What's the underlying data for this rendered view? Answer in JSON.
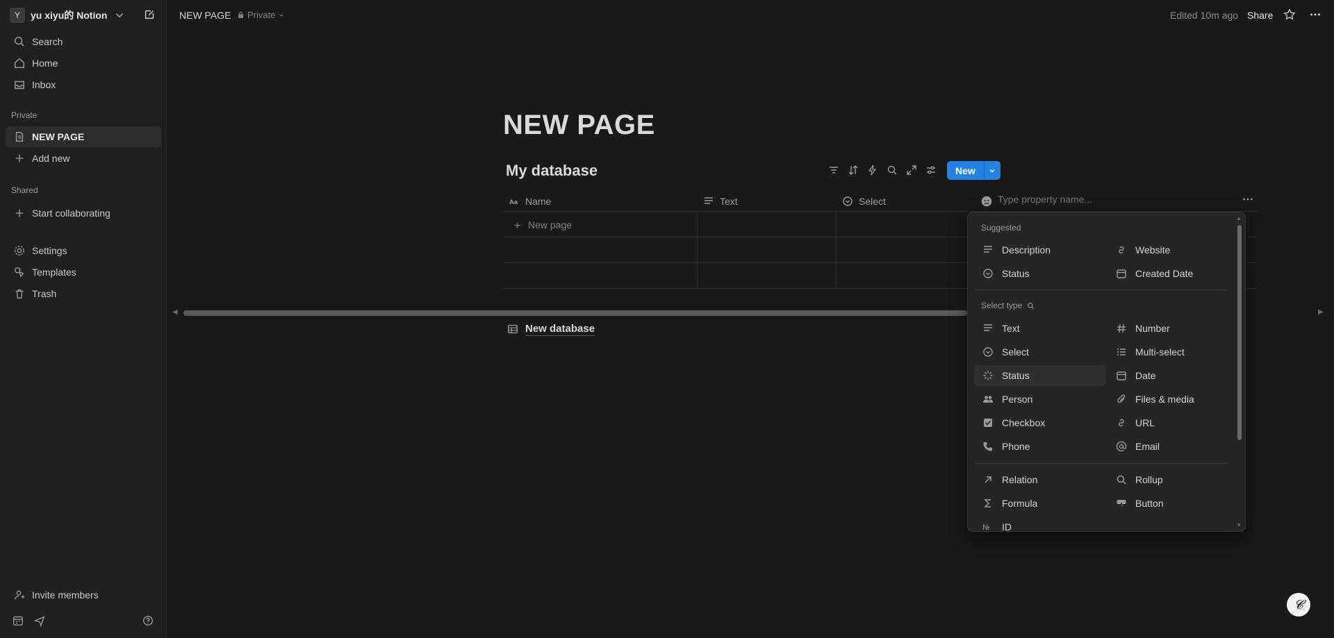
{
  "sidebar": {
    "workspace_initial": "Y",
    "workspace_name": "yu xiyu的 Notion",
    "top_items": [
      {
        "label": "Search",
        "icon": "search-icon"
      },
      {
        "label": "Home",
        "icon": "home-icon"
      },
      {
        "label": "Inbox",
        "icon": "inbox-icon"
      }
    ],
    "private_label": "Private",
    "private_items": [
      {
        "label": "NEW PAGE",
        "icon": "page-icon",
        "active": true
      },
      {
        "label": "Add new",
        "icon": "plus-icon"
      }
    ],
    "shared_label": "Shared",
    "shared_items": [
      {
        "label": "Start collaborating",
        "icon": "plus-icon"
      }
    ],
    "bottom_items": [
      {
        "label": "Settings",
        "icon": "gear-icon"
      },
      {
        "label": "Templates",
        "icon": "templates-icon"
      },
      {
        "label": "Trash",
        "icon": "trash-icon"
      }
    ],
    "invite_label": "Invite members"
  },
  "topbar": {
    "breadcrumb": "NEW PAGE",
    "privacy": "Private",
    "edited": "Edited 10m ago",
    "share": "Share"
  },
  "page": {
    "title": "NEW PAGE",
    "database_title": "My database",
    "new_button": "New",
    "columns": [
      {
        "label": "Name",
        "icon": "title-icon"
      },
      {
        "label": "Text",
        "icon": "text-icon"
      },
      {
        "label": "Select",
        "icon": "select-icon"
      }
    ],
    "property_placeholder": "Type property name...",
    "new_page_label": "New page",
    "new_database_label": "New database"
  },
  "dropdown": {
    "suggested_label": "Suggested",
    "suggested": [
      {
        "label": "Description",
        "icon": "text-icon"
      },
      {
        "label": "Website",
        "icon": "link-icon"
      },
      {
        "label": "Status",
        "icon": "select-icon"
      },
      {
        "label": "Created Date",
        "icon": "calendar-icon"
      }
    ],
    "select_type_label": "Select type",
    "types": [
      {
        "label": "Text",
        "icon": "text-icon"
      },
      {
        "label": "Number",
        "icon": "hash-icon"
      },
      {
        "label": "Select",
        "icon": "select-icon"
      },
      {
        "label": "Multi-select",
        "icon": "list-icon"
      },
      {
        "label": "Status",
        "icon": "status-icon",
        "highlighted": true
      },
      {
        "label": "Date",
        "icon": "calendar-icon"
      },
      {
        "label": "Person",
        "icon": "people-icon"
      },
      {
        "label": "Files & media",
        "icon": "paperclip-icon"
      },
      {
        "label": "Checkbox",
        "icon": "checkbox-icon"
      },
      {
        "label": "URL",
        "icon": "link-icon"
      },
      {
        "label": "Phone",
        "icon": "phone-icon"
      },
      {
        "label": "Email",
        "icon": "at-icon"
      }
    ],
    "advanced": [
      {
        "label": "Relation",
        "icon": "arrow-up-right-icon"
      },
      {
        "label": "Rollup",
        "icon": "search-icon"
      },
      {
        "label": "Formula",
        "icon": "sigma-icon"
      },
      {
        "label": "Button",
        "icon": "cursor-click-icon"
      },
      {
        "label": "ID",
        "icon": "numero-icon"
      }
    ]
  },
  "colors": {
    "background": "#191919",
    "sidebar": "#202020",
    "accent": "#2383e2"
  }
}
